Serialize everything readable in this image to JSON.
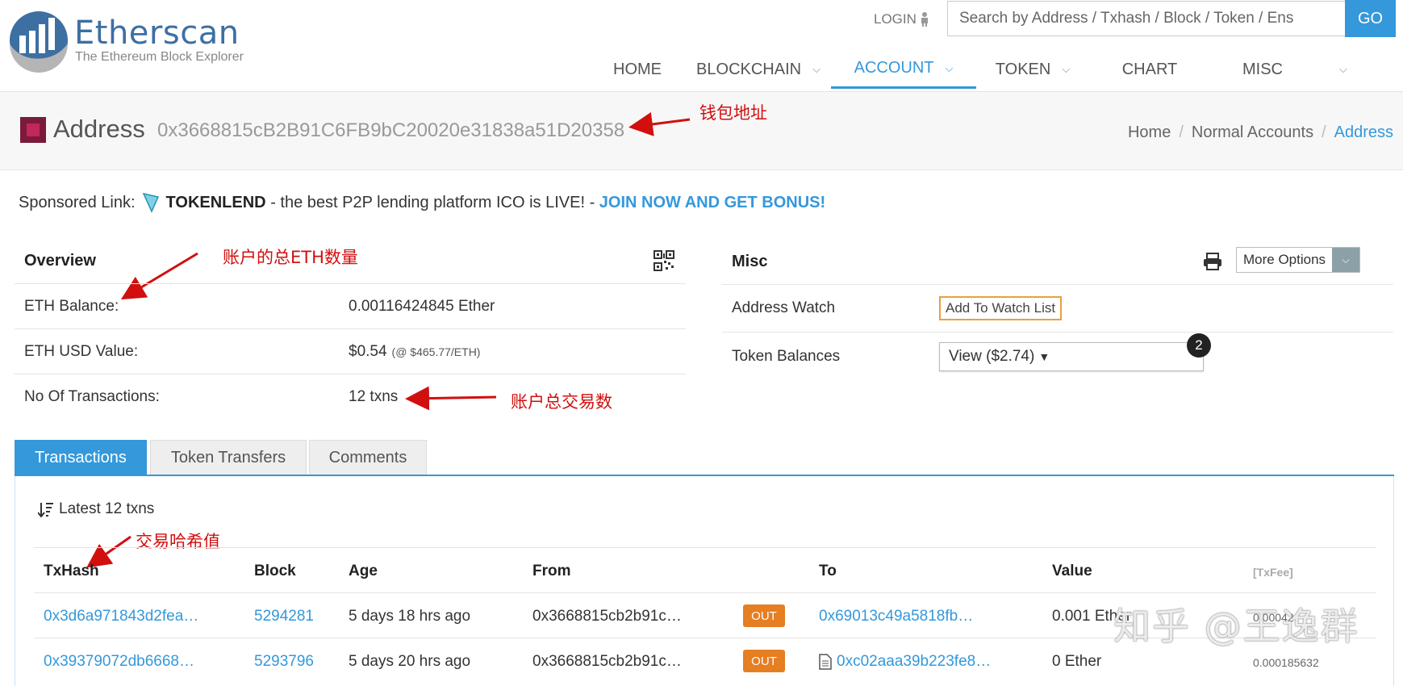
{
  "header": {
    "logo_text": "Etherscan",
    "logo_subtitle": "The Ethereum Block Explorer",
    "login_label": "LOGIN",
    "search_placeholder": "Search by Address / Txhash / Block / Token / Ens",
    "go_label": "GO",
    "nav": [
      {
        "label": "HOME",
        "has_dropdown": false,
        "active": false
      },
      {
        "label": "BLOCKCHAIN",
        "has_dropdown": true,
        "active": false
      },
      {
        "label": "ACCOUNT",
        "has_dropdown": true,
        "active": true
      },
      {
        "label": "TOKEN",
        "has_dropdown": true,
        "active": false
      },
      {
        "label": "CHART",
        "has_dropdown": false,
        "active": false
      },
      {
        "label": "MISC",
        "has_dropdown": true,
        "active": false
      }
    ]
  },
  "page": {
    "title": "Address",
    "address": "0x3668815cB2B91C6FB9bC20020e31838a51D20358",
    "breadcrumb": [
      "Home",
      "Normal Accounts",
      "Address"
    ]
  },
  "annotations": {
    "wallet_address": "钱包地址",
    "total_eth": "账户的总ETH数量",
    "total_txns": "账户总交易数",
    "tx_hash": "交易哈希值"
  },
  "sponsor": {
    "label": "Sponsored Link:",
    "brand": "TOKENLEND",
    "text": " - the best P2P lending platform ICO is LIVE! - ",
    "cta": "JOIN NOW AND GET BONUS!"
  },
  "overview": {
    "heading": "Overview",
    "rows": [
      {
        "label": "ETH Balance:",
        "value": "0.00116424845 Ether",
        "extra": ""
      },
      {
        "label": "ETH USD Value:",
        "value": "$0.54",
        "extra": "(@ $465.77/ETH)"
      },
      {
        "label": "No Of Transactions:",
        "value": "12 txns",
        "extra": ""
      }
    ]
  },
  "misc": {
    "heading": "Misc",
    "more_options": "More Options",
    "address_watch_label": "Address Watch",
    "add_watch_button": "Add To Watch List",
    "token_balances_label": "Token Balances",
    "token_view_button": "View ($2.74)",
    "token_count_badge": "2"
  },
  "tabs": [
    "Transactions",
    "Token Transfers",
    "Comments"
  ],
  "transactions": {
    "latest_label": "Latest 12 txns",
    "columns": [
      "TxHash",
      "Block",
      "Age",
      "From",
      "To",
      "Value",
      "[TxFee]"
    ],
    "rows": [
      {
        "txhash": "0x3d6a971843d2fea…",
        "block": "5294281",
        "age": "5 days 18 hrs ago",
        "from": "0x3668815cb2b91c…",
        "direction": "OUT",
        "to": "0x69013c49a5818fb…",
        "to_is_contract": false,
        "value": "0.001 Ether",
        "fee": "0.00042"
      },
      {
        "txhash": "0x39379072db6668…",
        "block": "5293796",
        "age": "5 days 20 hrs ago",
        "from": "0x3668815cb2b91c…",
        "direction": "OUT",
        "to": "0xc02aaa39b223fe8…",
        "to_is_contract": true,
        "value": "0 Ether",
        "fee": "0.000185632"
      }
    ]
  },
  "watermark": "知乎 @王逸群",
  "colors": {
    "accent": "#3498db",
    "out_badge": "#e67e22",
    "annotation": "#d10f0f",
    "watch_border": "#e8a040"
  }
}
